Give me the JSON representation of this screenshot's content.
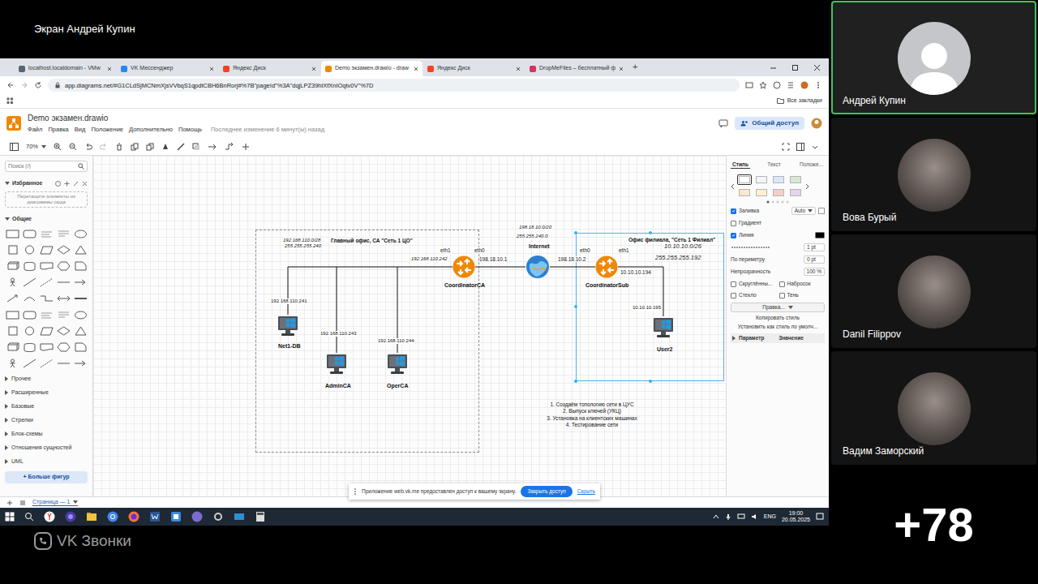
{
  "call": {
    "screen_title": "Экран Андрей Купин",
    "app_name": "VK Звонки",
    "more_count": "+78",
    "participants": [
      {
        "name": "Андрей Купин",
        "speaking": true,
        "kind": "placeholder"
      },
      {
        "name": "Вова Бурый",
        "speaking": false,
        "kind": "photo"
      },
      {
        "name": "Danil Filippov",
        "speaking": false,
        "kind": "photo"
      },
      {
        "name": "Вадим Заморский",
        "speaking": false,
        "kind": "photo"
      }
    ]
  },
  "browser": {
    "tabs": [
      {
        "label": "localhost.localdomain - VMw",
        "selected": false
      },
      {
        "label": "VK Мессенджер",
        "selected": false
      },
      {
        "label": "Яндекс Диск",
        "selected": false
      },
      {
        "label": "Demo экзамен.drawio - draw",
        "selected": true
      },
      {
        "label": "Яндекс Диск",
        "selected": false
      },
      {
        "label": "DropMeFiles – бесплатный ф",
        "selected": false
      }
    ],
    "new_tab": "+",
    "address": "app.diagrams.net/#G1CLdSjMCNmXjsVVbqS1qpdtCBH6BnRorj#%7B\"pageId\"%3A\"dqjLPZ39hlXfXnIOqtv0V\"%7D",
    "all_bookmarks": "Все закладки"
  },
  "app": {
    "title": "Demo экзамен.drawio",
    "menu": [
      "Файл",
      "Правка",
      "Вид",
      "Положение",
      "Дополнительно",
      "Помощь"
    ],
    "last_change": "Последнее изменение 6 минут(ы) назад",
    "share": "Общий доступ",
    "zoom": "70%",
    "page_tab": "Страница — 1"
  },
  "shapes_panel": {
    "search_placeholder": "Поиск (/)",
    "favorites": "Избранное",
    "favorites_hint": "Перетащите элементы из диаграммы сюда",
    "general": "Общие",
    "categories": [
      "Прочее",
      "Расширенные",
      "Базовые",
      "Стрелки",
      "Блок-схемы",
      "Отношения сущностей",
      "UML"
    ],
    "more_shapes": "+ Больше фигур"
  },
  "diagram": {
    "nodes": [
      {
        "name": "Net1-DB",
        "ip": "192.168.110.241",
        "kind": "pc"
      },
      {
        "name": "AdminCA",
        "ip": "192.168.110.243",
        "kind": "pc"
      },
      {
        "name": "OperCA",
        "ip": "192.168.110.244",
        "kind": "pc"
      },
      {
        "name": "User2",
        "ip": "10.10.10.195",
        "kind": "pc"
      },
      {
        "name": "CoordinatorCA",
        "ip": "",
        "kind": "router"
      },
      {
        "name": "CoordinatorSub",
        "ip": "",
        "kind": "router"
      },
      {
        "name": "Internet",
        "ip": "",
        "kind": "cloud"
      }
    ],
    "labels": [
      "192.168.110.0/28",
      "255.255.255.240",
      "Главный офис, СА \"Сеть 1 ЦО\"",
      "eth1",
      "eth0",
      "192.168.110.242",
      "198.18.10.1",
      "198.18.10.0/20",
      "255.255.240.0",
      "198.18.10.2",
      "eth0",
      "eth1",
      "Офис филиала, \"Сеть 1 Филиал\"",
      "10.10.10.0/26",
      "255.255.255.192",
      "10.10.10.194"
    ],
    "steps": [
      "1. Создаём топологию сети в ЦУС",
      "2. Выпуск ключей (УКЦ)",
      "3. Установка на клиентских машинах",
      "4. Тестирование сети"
    ]
  },
  "format_panel": {
    "tabs": [
      {
        "label": "Стиль",
        "selected": true
      },
      {
        "label": "Текст",
        "selected": false
      },
      {
        "label": "Положе...",
        "selected": false
      }
    ],
    "swatches": [
      {
        "color": "#ffffff",
        "selected": true
      },
      {
        "color": "#f5f5f5",
        "selected": false
      },
      {
        "color": "#dae8fc",
        "selected": false
      },
      {
        "color": "#d5e8d4",
        "selected": false
      },
      {
        "color": "#ffe6cc",
        "selected": false
      },
      {
        "color": "#fff2cc",
        "selected": false
      },
      {
        "color": "#f8cecc",
        "selected": false
      },
      {
        "color": "#e1d5e7",
        "selected": false
      }
    ],
    "fill": {
      "label": "Заливка",
      "checked": true,
      "value": "Auto"
    },
    "gradient": {
      "label": "Градиент",
      "checked": false
    },
    "line": {
      "label": "Линия",
      "checked": true,
      "width": "1 pt"
    },
    "perimeter": {
      "label": "По периметру",
      "value": "0 pt"
    },
    "opacity": {
      "label": "Непрозрачность",
      "value": "100 %"
    },
    "options": [
      {
        "label": "Скруглённы...",
        "checked": false
      },
      {
        "label": "Набросок",
        "checked": false
      },
      {
        "label": "Стекло",
        "checked": false
      },
      {
        "label": "Тень",
        "checked": false
      }
    ],
    "edit": "Правка...",
    "copy_style": "Копировать стиль",
    "set_default": "Установить как стиль по умолч...",
    "columns": [
      "Параметр",
      "Значение"
    ]
  },
  "notification": {
    "text": "Приложение web.vk.me предоставлен доступ к вашему экрану.",
    "button": "Закрыть доступ",
    "link": "Скрыть"
  },
  "taskbar": {
    "lang": "ENG",
    "time": "19:00",
    "date": "20.05.2025"
  }
}
